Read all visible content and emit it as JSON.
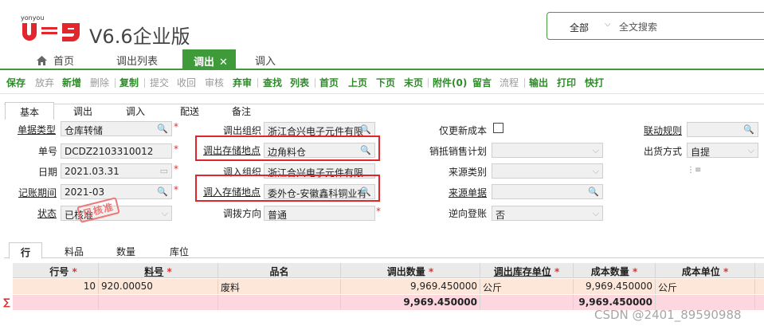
{
  "header": {
    "brand": "yonyou",
    "logo": "U9",
    "version": "V6.6企业版",
    "search_scope": "全部",
    "search_placeholder": "全文搜索"
  },
  "tabs": [
    {
      "label": "首页",
      "icon": "home-icon"
    },
    {
      "label": "调出列表"
    },
    {
      "label": "调出",
      "active": true,
      "close": "✕"
    },
    {
      "label": "调入"
    }
  ],
  "toolbar": [
    "保存",
    "放弃",
    "新增",
    "删除",
    "复制",
    "提交",
    "收回",
    "审核",
    "弃审",
    "查找",
    "列表",
    "首页",
    "上页",
    "下页",
    "末页",
    "附件(0)",
    "留言",
    "流程",
    "输出",
    "打印",
    "快打"
  ],
  "form_tabs": [
    "基本",
    "调出",
    "调入",
    "配送",
    "备注"
  ],
  "form": {
    "doc_type_label": "单据类型",
    "doc_type": "仓库转储",
    "doc_no_label": "单号",
    "doc_no": "DCDZ2103310012",
    "date_label": "日期",
    "date": "2021.03.31",
    "period_label": "记账期间",
    "period": "2021-03",
    "status_label": "状态",
    "status": "已核准",
    "stamp": "已核准",
    "out_org_label": "调出组织",
    "out_org": "浙江合兴电子元件有限",
    "out_loc_label": "调出存储地点",
    "out_loc": "边角料仓",
    "in_org_label": "调入组织",
    "in_org": "浙江合兴电子元件有限",
    "in_loc_label": "调入存储地点",
    "in_loc": "委外仓-安徽鑫科铜业有",
    "direction_label": "调拨方向",
    "direction": "普通",
    "update_cost_label": "仅更新成本",
    "sales_plan_label": "销抵销售计划",
    "source_type_label": "来源类别",
    "source_doc_label": "来源单据",
    "reverse_label": "逆向登账",
    "reverse": "否",
    "linked_rule_label": "联动规则",
    "ship_mode_label": "出货方式",
    "ship_mode": "自提"
  },
  "grid_tabs": [
    "行",
    "料品",
    "数量",
    "库位"
  ],
  "grid": {
    "columns": [
      "行号",
      "料号",
      "品名",
      "调出数量",
      "调出库存单位",
      "成本数量",
      "成本单位"
    ],
    "rows": [
      {
        "line": "10",
        "item_no": "920.00050",
        "name": "废料",
        "qty": "9,969.450000",
        "unit": "公斤",
        "cost_qty": "9,969.450000",
        "cost_unit": "公斤"
      }
    ],
    "sum_symbol": "∑",
    "sum_qty": "9,969.450000",
    "sum_cost_qty": "9,969.450000"
  },
  "watermark": "CSDN @2401_89590988"
}
